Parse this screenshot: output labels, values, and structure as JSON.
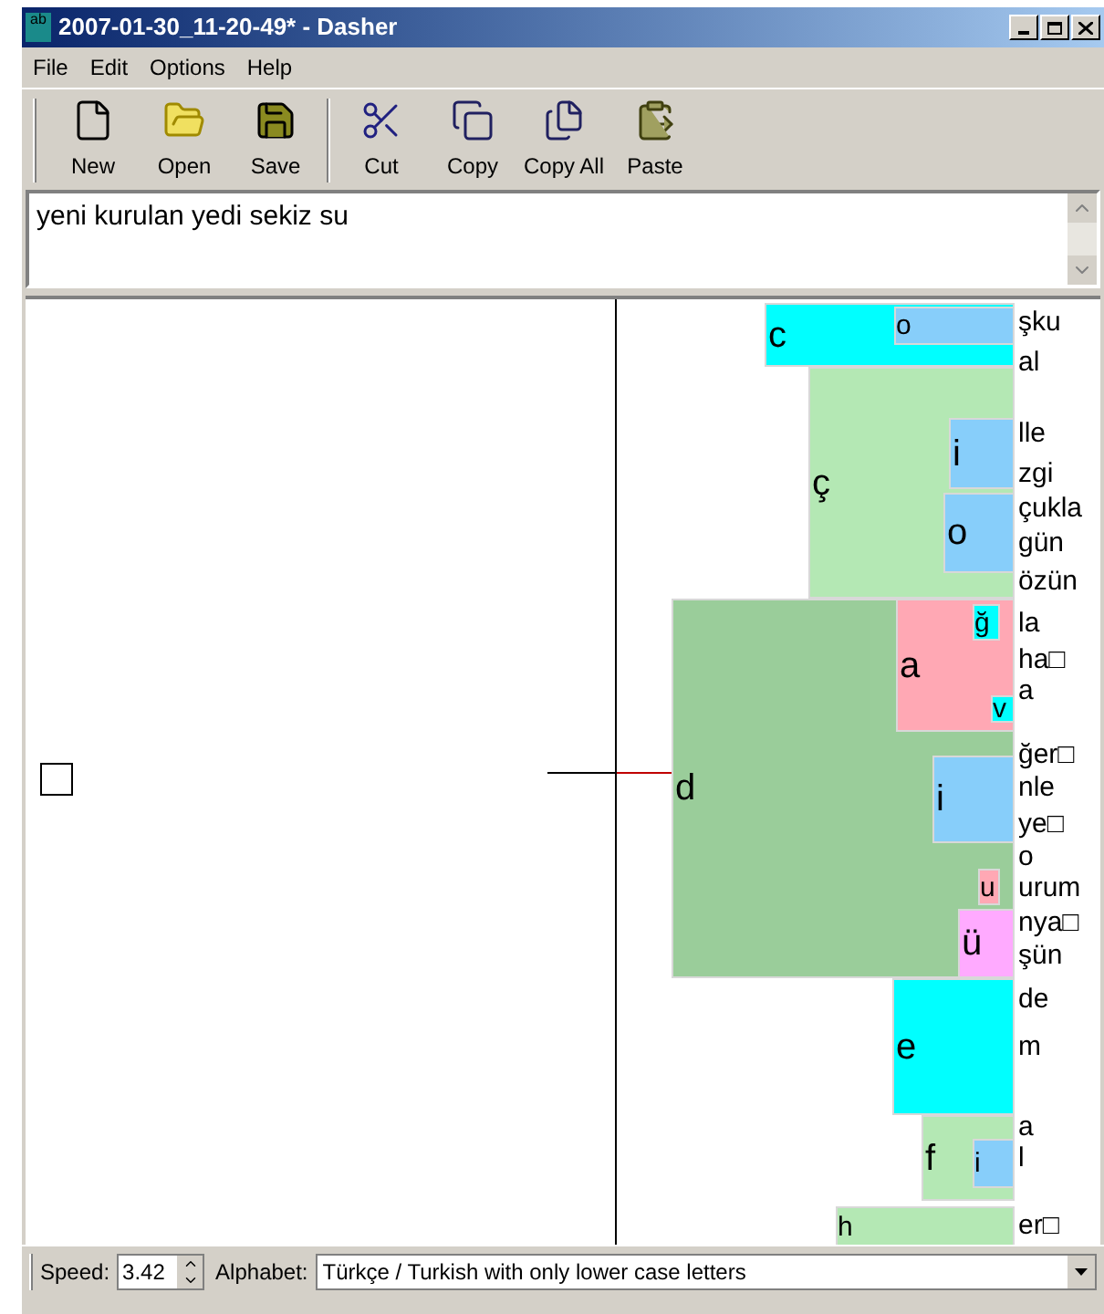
{
  "window": {
    "title": "2007-01-30_11-20-49* - Dasher",
    "icon": "ab"
  },
  "menu": [
    "File",
    "Edit",
    "Options",
    "Help"
  ],
  "toolbar": [
    {
      "label": "New",
      "kind": "new"
    },
    {
      "label": "Open",
      "kind": "open"
    },
    {
      "label": "Save",
      "kind": "save"
    },
    {
      "label": "Cut",
      "kind": "cut"
    },
    {
      "label": "Copy",
      "kind": "copy"
    },
    {
      "label": "Copy All",
      "kind": "copyall"
    },
    {
      "label": "Paste",
      "kind": "paste"
    }
  ],
  "editor": {
    "value": "yeni kurulan yedi sekiz su"
  },
  "canvas": {
    "boxes": [
      {
        "letter": "c",
        "color": "#00ffff",
        "children": [
          {
            "letter": "o",
            "color": "#87cefa"
          }
        ]
      },
      {
        "letter": "ç",
        "color": "#b4e8b4",
        "children": [
          {
            "letter": "i",
            "color": "#87cefa"
          },
          {
            "letter": "o",
            "color": "#87cefa"
          }
        ]
      },
      {
        "letter": "d",
        "color": "#9acd9a",
        "children": [
          {
            "letter": "a",
            "color": "#ffa8b4",
            "children": [
              {
                "letter": "ğ",
                "color": "#00ffff"
              },
              {
                "letter": "v",
                "color": "#00ffff"
              }
            ]
          },
          {
            "letter": "i",
            "color": "#87cefa"
          },
          {
            "letter": "u",
            "color": "#ffa8b4"
          },
          {
            "letter": "ü",
            "color": "#ffaaff"
          }
        ]
      },
      {
        "letter": "e",
        "color": "#00ffff"
      },
      {
        "letter": "f",
        "color": "#b4e8b4",
        "children": [
          {
            "letter": "i",
            "color": "#87cefa"
          }
        ]
      },
      {
        "letter": "h",
        "color": "#b4e8b4"
      }
    ],
    "labels": [
      "şku",
      "al",
      "lle",
      "zgi",
      "çukla",
      "gün",
      "özün",
      "la",
      "ha□",
      "a",
      "ğer□",
      "nle",
      "ye□",
      "o",
      "urum",
      "nya□",
      "şün",
      "de",
      "m",
      "a",
      "l",
      "er□"
    ]
  },
  "status": {
    "speed_label": "Speed:",
    "speed": "3.42",
    "alphabet_label": "Alphabet:",
    "alphabet": "Türkçe / Turkish with only lower case letters"
  }
}
